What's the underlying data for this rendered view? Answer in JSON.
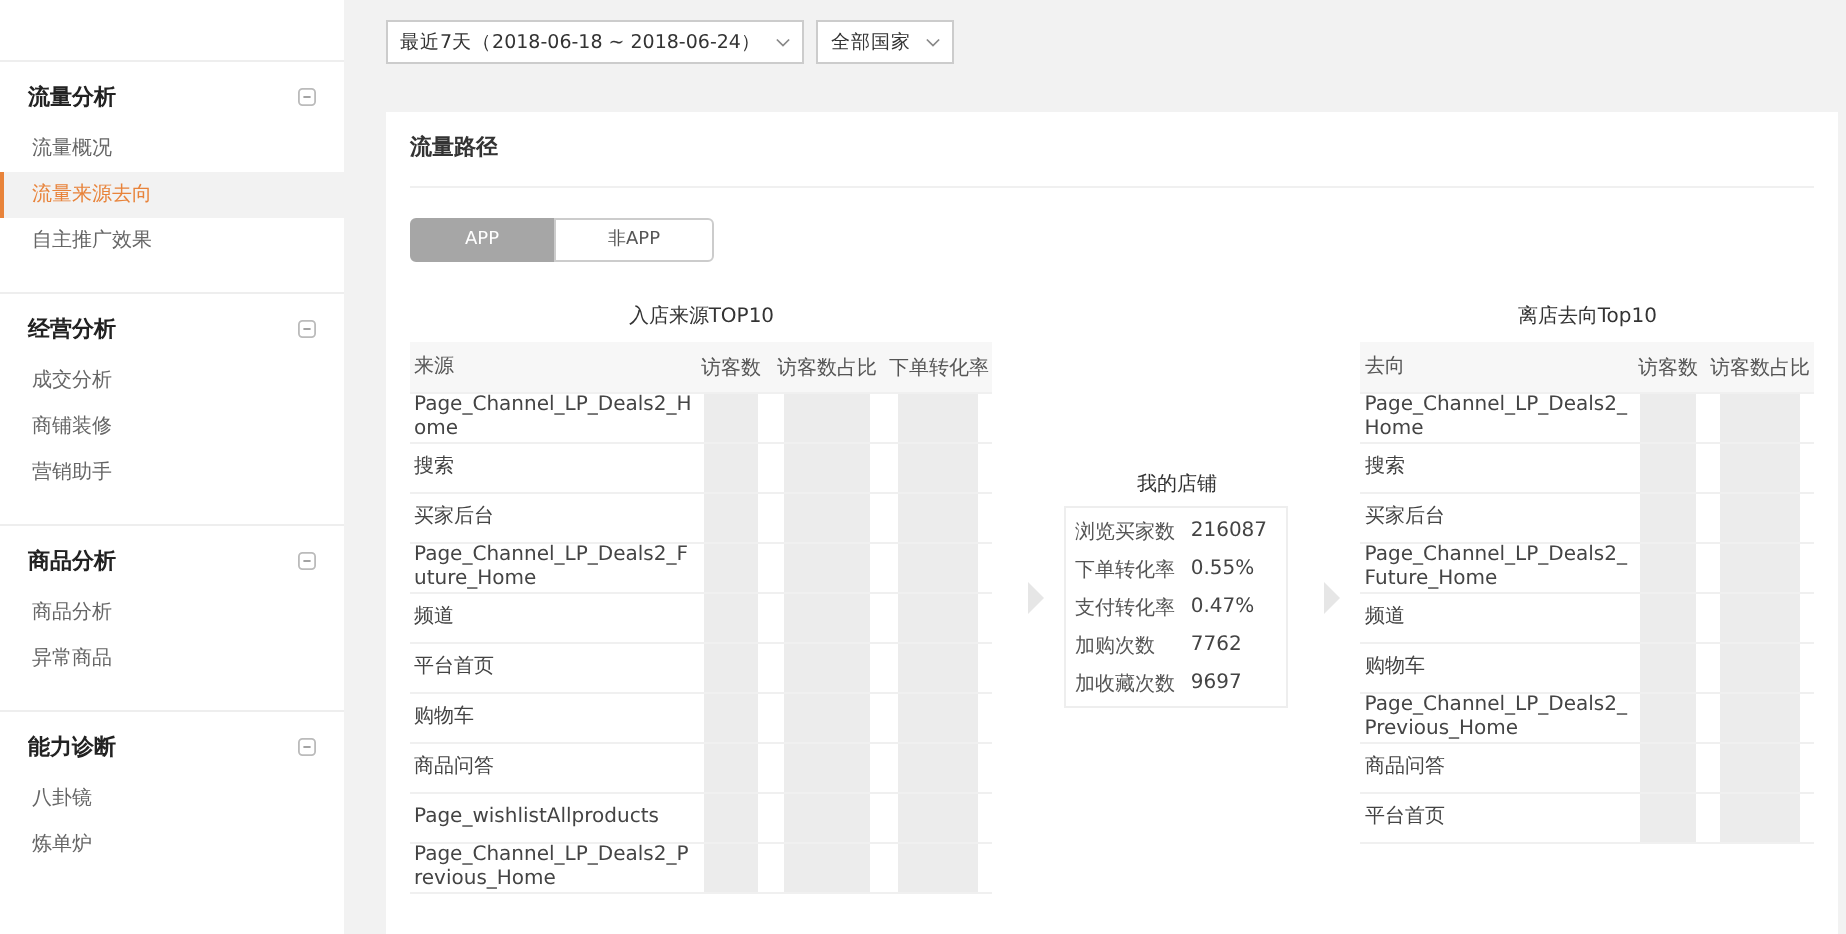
{
  "sidebar": {
    "groups": [
      {
        "title": "流量分析",
        "expanded": true,
        "items": [
          {
            "label": "流量概况",
            "selected": false
          },
          {
            "label": "流量来源去向",
            "selected": true
          },
          {
            "label": "自主推广效果",
            "selected": false
          }
        ]
      },
      {
        "title": "经营分析",
        "expanded": true,
        "items": [
          {
            "label": "成交分析",
            "selected": false
          },
          {
            "label": "商铺装修",
            "selected": false
          },
          {
            "label": "营销助手",
            "selected": false
          }
        ]
      },
      {
        "title": "商品分析",
        "expanded": true,
        "items": [
          {
            "label": "商品分析",
            "selected": false
          },
          {
            "label": "异常商品",
            "selected": false
          }
        ]
      },
      {
        "title": "能力诊断",
        "expanded": true,
        "items": [
          {
            "label": "八卦镜",
            "selected": false
          },
          {
            "label": "炼单炉",
            "selected": false
          }
        ]
      }
    ]
  },
  "filters": [
    {
      "value": "最近7天（2018-06-18 ~ 2018-06-24）"
    },
    {
      "value": "全部国家"
    }
  ],
  "panel": {
    "title": "流量路径",
    "tabs": [
      {
        "label": "APP",
        "selected": true
      },
      {
        "label": "非APP",
        "selected": false
      }
    ],
    "entry_table": {
      "title": "入店来源TOP10",
      "columns": [
        "来源",
        "访客数",
        "访客数占比",
        "下单转化率"
      ],
      "rows": [
        {
          "name": "Page_Channel_LP_Deals2_Home"
        },
        {
          "name": "搜索"
        },
        {
          "name": "买家后台"
        },
        {
          "name": "Page_Channel_LP_Deals2_Future_Home"
        },
        {
          "name": "频道"
        },
        {
          "name": "平台首页"
        },
        {
          "name": "购物车"
        },
        {
          "name": "商品问答"
        },
        {
          "name": "Page_wishlistAllproducts"
        },
        {
          "name": "Page_Channel_LP_Deals2_Previous_Home"
        }
      ]
    },
    "store": {
      "title": "我的店铺",
      "stats": [
        {
          "label": "浏览买家数",
          "value": "216087"
        },
        {
          "label": "下单转化率",
          "value": "0.55%"
        },
        {
          "label": "支付转化率",
          "value": "0.47%"
        },
        {
          "label": "加购次数",
          "value": "7762"
        },
        {
          "label": "加收藏次数",
          "value": "9697"
        }
      ]
    },
    "exit_table": {
      "title": "离店去向Top10",
      "columns": [
        "去向",
        "访客数",
        "访客数占比"
      ],
      "rows": [
        {
          "name": "Page_Channel_LP_Deals2_Home"
        },
        {
          "name": "搜索"
        },
        {
          "name": "买家后台"
        },
        {
          "name": "Page_Channel_LP_Deals2_Future_Home"
        },
        {
          "name": "频道"
        },
        {
          "name": "购物车"
        },
        {
          "name": "Page_Channel_LP_Deals2_Previous_Home"
        },
        {
          "name": "商品问答"
        },
        {
          "name": "平台首页"
        }
      ]
    }
  }
}
